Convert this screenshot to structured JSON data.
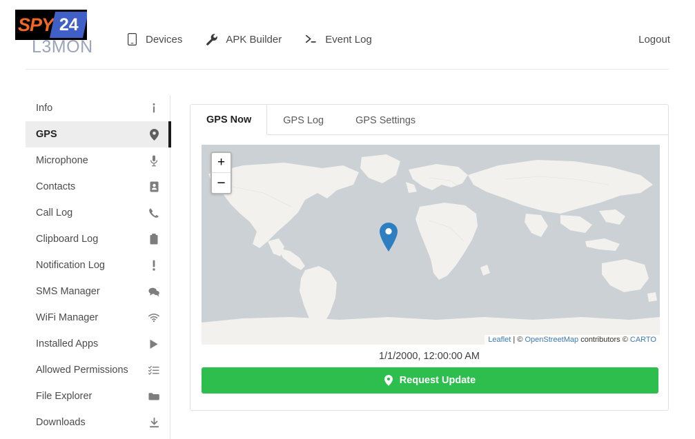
{
  "header": {
    "logo": {
      "spy_text": "SPY",
      "slash": "/",
      "badge_text": "24",
      "product_name": "L3MON"
    },
    "nav": [
      {
        "label": "Devices",
        "icon": "mobile-icon"
      },
      {
        "label": "APK Builder",
        "icon": "wrench-icon"
      },
      {
        "label": "Event Log",
        "icon": "terminal-icon"
      }
    ],
    "logout_label": "Logout"
  },
  "sidebar": {
    "items": [
      {
        "label": "Info",
        "icon": "info-icon",
        "active": false
      },
      {
        "label": "GPS",
        "icon": "map-pin-icon",
        "active": true
      },
      {
        "label": "Microphone",
        "icon": "microphone-icon",
        "active": false
      },
      {
        "label": "Contacts",
        "icon": "contact-card-icon",
        "active": false
      },
      {
        "label": "Call Log",
        "icon": "phone-icon",
        "active": false
      },
      {
        "label": "Clipboard Log",
        "icon": "clipboard-icon",
        "active": false
      },
      {
        "label": "Notification Log",
        "icon": "exclamation-icon",
        "active": false
      },
      {
        "label": "SMS Manager",
        "icon": "chat-bubbles-icon",
        "active": false
      },
      {
        "label": "WiFi Manager",
        "icon": "wifi-icon",
        "active": false
      },
      {
        "label": "Installed Apps",
        "icon": "play-store-icon",
        "active": false
      },
      {
        "label": "Allowed Permissions",
        "icon": "checklist-icon",
        "active": false
      },
      {
        "label": "File Explorer",
        "icon": "folder-icon",
        "active": false
      },
      {
        "label": "Downloads",
        "icon": "download-icon",
        "active": false
      }
    ]
  },
  "main": {
    "tabs": [
      {
        "label": "GPS Now",
        "active": true
      },
      {
        "label": "GPS Log",
        "active": false
      },
      {
        "label": "GPS Settings",
        "active": false
      }
    ],
    "map": {
      "zoom_in_label": "+",
      "zoom_out_label": "−",
      "marker_icon": "map-marker-icon",
      "attribution": {
        "leaflet": "Leaflet",
        "separator": " | © ",
        "osm": "OpenStreetMap",
        "contributors": " contributors © ",
        "carto": "CARTO"
      },
      "colors": {
        "ocean": "#cbd1d4",
        "land": "#f2f1ed",
        "marker": "#2e7fc1"
      }
    },
    "timestamp": "1/1/2000, 12:00:00 AM",
    "request_button": {
      "label": "Request Update",
      "icon": "map-pin-icon",
      "color": "#2dbe4e"
    }
  }
}
